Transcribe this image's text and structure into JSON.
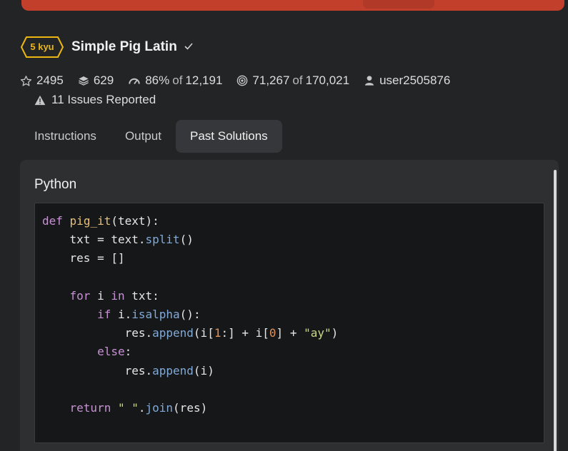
{
  "kata": {
    "rank": "5 kyu",
    "title": "Simple Pig Latin"
  },
  "stats": {
    "stars": "2495",
    "collections": "629",
    "satisfaction": "86%",
    "satisfaction_of_label": "of",
    "satisfaction_votes": "12,191",
    "completed": "71,267",
    "completed_of_label": "of",
    "attempted": "170,021",
    "author": "user2505876"
  },
  "issues": "11 Issues Reported",
  "tabs": [
    "Instructions",
    "Output",
    "Past Solutions"
  ],
  "active_tab": "Past Solutions",
  "panel": {
    "language": "Python"
  },
  "code": {
    "line1": {
      "kw": "def",
      "fn": "pig_it",
      "rest": "(text):"
    },
    "line2": {
      "a": "    txt = text.",
      "m": "split",
      "b": "()"
    },
    "line3": "    res = []",
    "line5": {
      "a": "    ",
      "kw": "for",
      "b": " i ",
      "kw2": "in",
      "c": " txt:"
    },
    "line6": {
      "a": "        ",
      "kw": "if",
      "b": " i.",
      "m": "isalpha",
      "c": "():"
    },
    "line7": {
      "a": "            res.",
      "m": "append",
      "b": "(i[",
      "n1": "1",
      "c": ":] + i[",
      "n2": "0",
      "d": "] + ",
      "s": "\"ay\"",
      "e": ")"
    },
    "line8": {
      "a": "        ",
      "kw": "else",
      "b": ":"
    },
    "line9": {
      "a": "            res.",
      "m": "append",
      "b": "(i)"
    },
    "line11": {
      "a": "    ",
      "kw": "return",
      "b": " ",
      "s": "\" \"",
      "c": ".",
      "m": "join",
      "d": "(res)"
    }
  },
  "colors": {
    "background": "#232426",
    "banner": "#c2402b",
    "rank_badge": "#ecb613",
    "code_background": "#161719"
  }
}
